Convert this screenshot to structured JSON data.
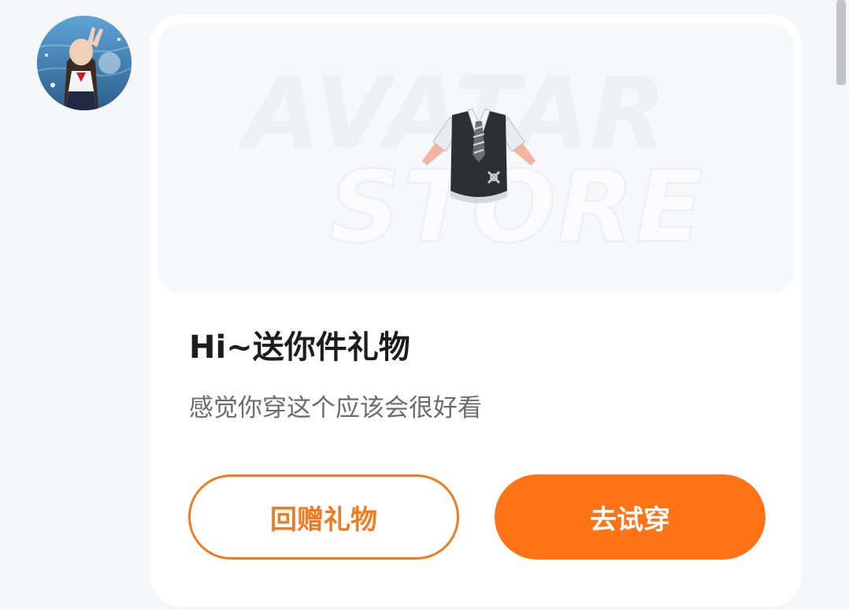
{
  "avatar": {
    "description_icon": "user-avatar-photo"
  },
  "gift_card": {
    "preview": {
      "watermark_line_1": "AVATAR",
      "watermark_line_2": "STORE",
      "item_icon": "shirt-vest-item"
    },
    "title": "Hi~送你件礼物",
    "subtitle": "感觉你穿这个应该会很好看",
    "buttons": {
      "return_gift_label": "回赠礼物",
      "try_on_label": "去试穿"
    }
  },
  "colors": {
    "accent": "#ff7317",
    "accent_outline": "#f07c22",
    "page_background": "#f5f6f8",
    "card_background": "#ffffff"
  }
}
